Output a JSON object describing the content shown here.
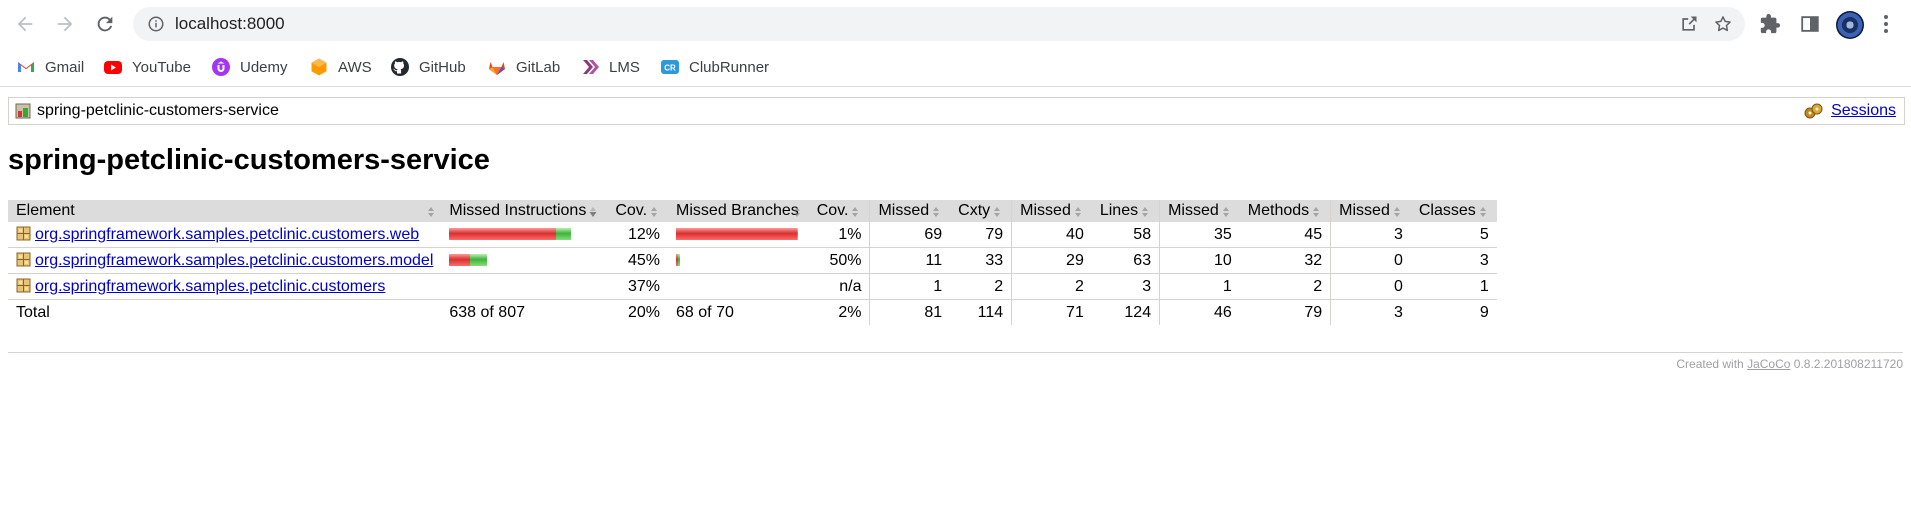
{
  "browser": {
    "url": "localhost:8000",
    "bookmarks": [
      {
        "label": "Gmail",
        "icon": "gmail-icon"
      },
      {
        "label": "YouTube",
        "icon": "youtube-icon"
      },
      {
        "label": "Udemy",
        "icon": "udemy-icon"
      },
      {
        "label": "AWS",
        "icon": "aws-icon"
      },
      {
        "label": "GitHub",
        "icon": "github-icon"
      },
      {
        "label": "GitLab",
        "icon": "gitlab-icon"
      },
      {
        "label": "LMS",
        "icon": "lms-icon"
      },
      {
        "label": "ClubRunner",
        "icon": "clubrunner-icon"
      }
    ]
  },
  "breadcrumb": {
    "label": "spring-petclinic-customers-service",
    "sessions_label": "Sessions"
  },
  "page_title": "spring-petclinic-customers-service",
  "table": {
    "headers": {
      "element": "Element",
      "missed_instructions": "Missed Instructions",
      "cov1": "Cov.",
      "missed_branches": "Missed Branches",
      "cov2": "Cov.",
      "missed_cxty": "Missed",
      "cxty": "Cxty",
      "missed_lines": "Missed",
      "lines": "Lines",
      "missed_methods": "Missed",
      "methods": "Methods",
      "missed_classes": "Missed",
      "classes": "Classes"
    },
    "rows": [
      {
        "element": "org.springframework.samples.petclinic.customers.web",
        "instr_bar": {
          "missed_fraction": 0.88,
          "scale": 1.0
        },
        "instr_cov": "12%",
        "branch_bar": {
          "missed_fraction": 0.99,
          "scale": 1.0
        },
        "branch_cov": "1%",
        "missed_cxty": "69",
        "cxty": "79",
        "missed_lines": "40",
        "lines": "58",
        "missed_methods": "35",
        "methods": "45",
        "missed_classes": "3",
        "classes": "5"
      },
      {
        "element": "org.springframework.samples.petclinic.customers.model",
        "instr_bar": {
          "missed_fraction": 0.55,
          "scale": 0.31
        },
        "instr_cov": "45%",
        "branch_bar": {
          "missed_fraction": 0.5,
          "scale": 0.03
        },
        "branch_cov": "50%",
        "missed_cxty": "11",
        "cxty": "33",
        "missed_lines": "29",
        "lines": "63",
        "missed_methods": "10",
        "methods": "32",
        "missed_classes": "0",
        "classes": "3"
      },
      {
        "element": "org.springframework.samples.petclinic.customers",
        "instr_bar": null,
        "instr_cov": "37%",
        "branch_bar": null,
        "branch_cov": "n/a",
        "missed_cxty": "1",
        "cxty": "2",
        "missed_lines": "2",
        "lines": "3",
        "missed_methods": "1",
        "methods": "2",
        "missed_classes": "0",
        "classes": "1"
      }
    ],
    "total": {
      "label": "Total",
      "missed_instructions": "638 of 807",
      "instr_cov": "20%",
      "missed_branches": "68 of 70",
      "branch_cov": "2%",
      "missed_cxty": "81",
      "cxty": "114",
      "missed_lines": "71",
      "lines": "124",
      "missed_methods": "46",
      "methods": "79",
      "missed_classes": "3",
      "classes": "9"
    }
  },
  "footer": {
    "prefix": "Created with",
    "link": "JaCoCo",
    "version": "0.8.2.201808211720"
  },
  "colors": {
    "link": "#0000cc",
    "missed_bar": "#d83030",
    "covered_bar": "#3fb23a",
    "header_bg": "#dcdcdc"
  }
}
